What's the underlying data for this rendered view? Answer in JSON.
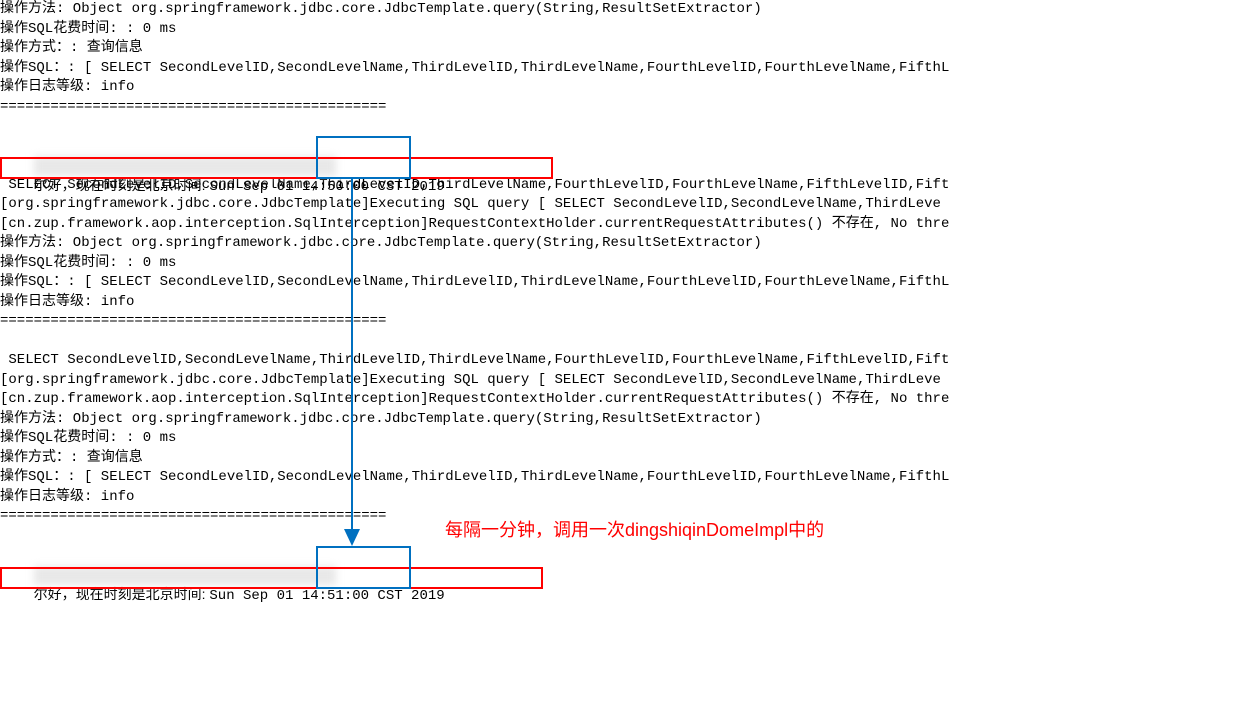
{
  "lines": {
    "l0": "操作方法: Object org.springframework.jdbc.core.JdbcTemplate.query(String,ResultSetExtractor)",
    "l1": "操作SQL花费时间: : 0 ms",
    "l2": "操作方式：: 查询信息",
    "l3": "操作SQL：: [ SELECT SecondLevelID,SecondLevelName,ThirdLevelID,ThirdLevelName,FourthLevelID,FourthLevelName,FifthL",
    "l4": "操作日志等级: info",
    "l5": "==============================================",
    "l6": "",
    "l7_blur": "                                    ",
    "l8_prefix": "尔好，现在时刻是北京时间: ",
    "l8_date": "Sun Sep 01 ",
    "l8_time": "14:50:00",
    "l8_suffix": " CST 2019",
    "l9": " SELECT SecondLevelID,SecondLevelName,ThirdLevelID,ThirdLevelName,FourthLevelID,FourthLevelName,FifthLevelID,Fift",
    "l10": "[org.springframework.jdbc.core.JdbcTemplate]Executing SQL query [ SELECT SecondLevelID,SecondLevelName,ThirdLeve",
    "l11": "[cn.zup.framework.aop.interception.SqlInterception]RequestContextHolder.currentRequestAttributes() 不存在, No thre",
    "l12": "操作方法: Object org.springframework.jdbc.core.JdbcTemplate.query(String,ResultSetExtractor)",
    "l13": "操作SQL花费时间: : 0 ms",
    "l14": "操作SQL：: [ SELECT SecondLevelID,SecondLevelName,ThirdLevelID,ThirdLevelName,FourthLevelID,FourthLevelName,FifthL",
    "l15": "操作日志等级: info",
    "l16": "==============================================",
    "l17": "",
    "l18": " SELECT SecondLevelID,SecondLevelName,ThirdLevelID,ThirdLevelName,FourthLevelID,FourthLevelName,FifthLevelID,Fift",
    "l19": "[org.springframework.jdbc.core.JdbcTemplate]Executing SQL query [ SELECT SecondLevelID,SecondLevelName,ThirdLeve",
    "l20": "[cn.zup.framework.aop.interception.SqlInterception]RequestContextHolder.currentRequestAttributes() 不存在, No thre",
    "l21": "操作方法: Object org.springframework.jdbc.core.JdbcTemplate.query(String,ResultSetExtractor)",
    "l22": "操作SQL花费时间: : 0 ms",
    "l23": "操作方式：: 查询信息",
    "l24": "操作SQL：: [ SELECT SecondLevelID,SecondLevelName,ThirdLevelID,ThirdLevelName,FourthLevelID,FourthLevelName,FifthL",
    "l25": "操作日志等级: info",
    "l26": "==============================================",
    "l27": "",
    "l28_blur": "                                    ",
    "l29_prefix": "尔好，现在时刻是北京时间: ",
    "l29_date": "Sun Sep 01 ",
    "l29_time": "14:51:00",
    "l29_suffix": " CST 2019"
  },
  "annotation": "每隔一分钟，调用一次dingshiqinDomeImpl中的"
}
